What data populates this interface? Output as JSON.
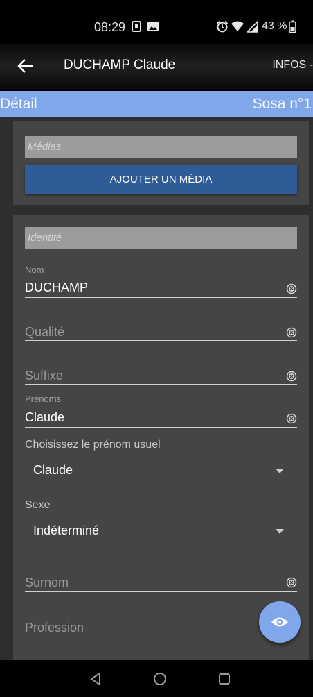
{
  "status": {
    "time": "08:29",
    "battery": "43 %"
  },
  "appbar": {
    "title": "DUCHAMP Claude",
    "menu_label": "INFOS -"
  },
  "detail": {
    "left": "Détail",
    "right": "Sosa n°1"
  },
  "medias": {
    "header": "Médias",
    "add_button": "AJOUTER UN MÉDIA"
  },
  "identity": {
    "header": "Identité",
    "nom": {
      "label": "Nom",
      "value": "DUCHAMP"
    },
    "qualite": {
      "placeholder": "Qualité"
    },
    "suffixe": {
      "placeholder": "Suffixe"
    },
    "prenoms": {
      "label": "Prénoms",
      "value": "Claude"
    },
    "prenom_usuel": {
      "label": "Choisissez le prénom usuel",
      "value": "Claude"
    },
    "sexe": {
      "label": "Sexe",
      "value": "Indéterminé"
    },
    "surnom": {
      "placeholder": "Surnom"
    },
    "profession": {
      "placeholder": "Profession"
    }
  },
  "icons": {
    "back": "arrow-left-icon",
    "clear": "clear-circle-icon",
    "dropdown": "caret-down-icon",
    "fab": "eye-icon",
    "nav": [
      "back-triangle-icon",
      "home-circle-icon",
      "recents-square-icon"
    ]
  },
  "colors": {
    "accent": "#7fa7e9",
    "button": "#2f5b96",
    "card": "#454545",
    "background": "#2e2e2e"
  }
}
